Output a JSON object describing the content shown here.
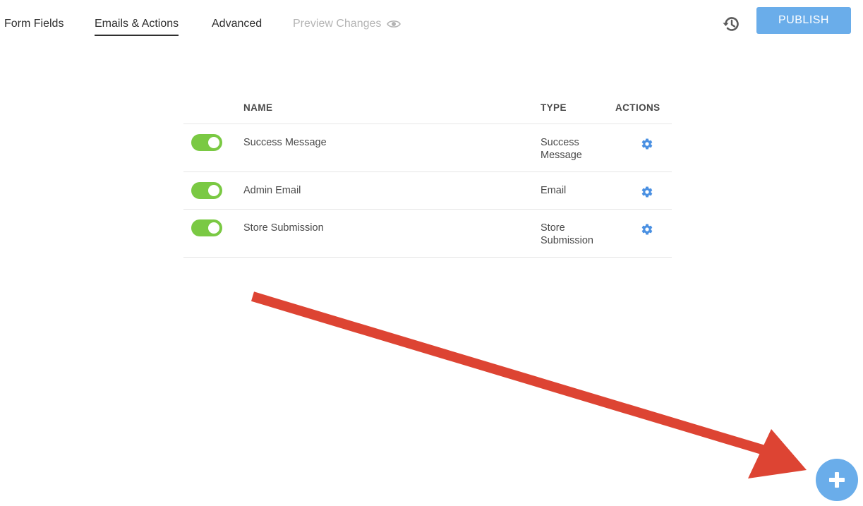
{
  "nav": {
    "tabs": [
      {
        "label": "Form Fields",
        "active": false,
        "disabled": false
      },
      {
        "label": "Emails & Actions",
        "active": true,
        "disabled": false
      },
      {
        "label": "Advanced",
        "active": false,
        "disabled": false
      },
      {
        "label": "Preview Changes",
        "active": false,
        "disabled": true,
        "icon": "eye-icon"
      }
    ],
    "history_icon": "history-icon",
    "publish_label": "PUBLISH"
  },
  "table": {
    "headers": {
      "name": "NAME",
      "type": "TYPE",
      "actions": "ACTIONS"
    },
    "rows": [
      {
        "enabled": true,
        "name": "Success Message",
        "type": "Success Message",
        "action_icon": "gear-icon"
      },
      {
        "enabled": true,
        "name": "Admin Email",
        "type": "Email",
        "action_icon": "gear-icon"
      },
      {
        "enabled": true,
        "name": "Store Submission",
        "type": "Store Submission",
        "action_icon": "gear-icon"
      }
    ]
  },
  "annotation": {
    "type": "arrow",
    "color": "#dd4433",
    "points_to": "add-action-button"
  },
  "add_button": {
    "icon": "plus-icon"
  },
  "colors": {
    "accent": "#6aadea",
    "toggle_on": "#7ac943",
    "disabled_text": "#b4b4b4",
    "annotation_red": "#dd4433"
  }
}
